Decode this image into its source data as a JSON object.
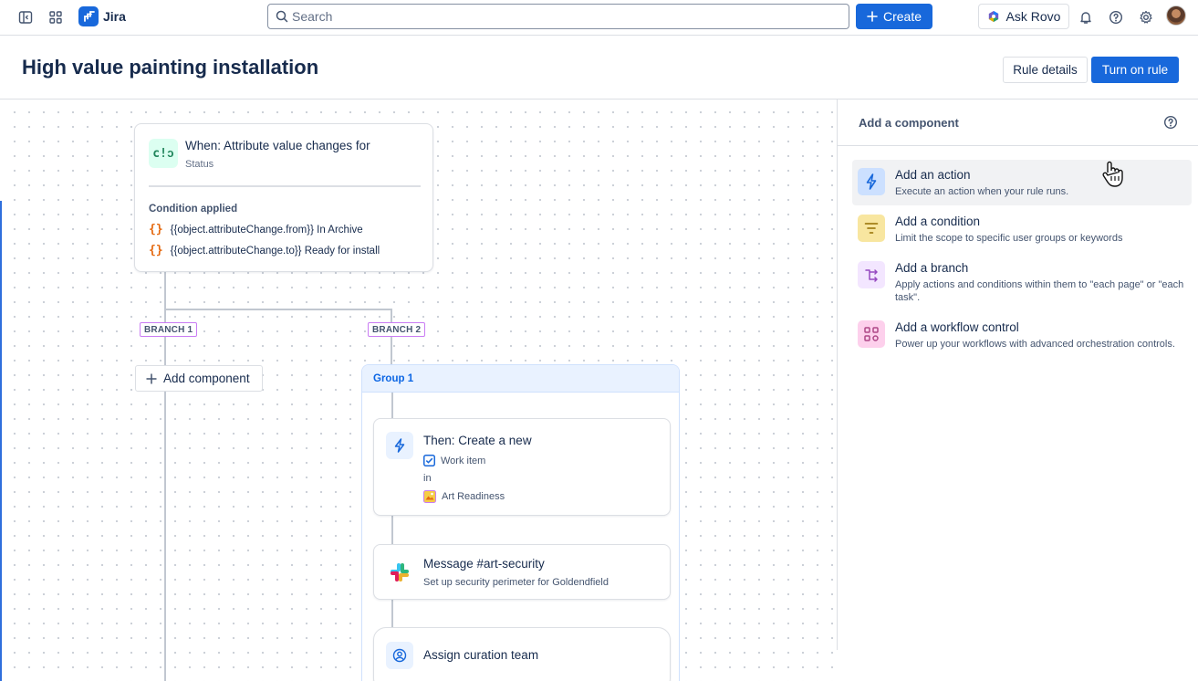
{
  "topnav": {
    "brand": "Jira",
    "search_placeholder": "Search",
    "create_label": "Create",
    "ask_rovo_label": "Ask Rovo",
    "icons": [
      "sidebar-toggle-icon",
      "app-switcher-icon",
      "jira-logo-icon",
      "bell-icon",
      "help-icon",
      "settings-icon",
      "avatar"
    ]
  },
  "header": {
    "title": "High value painting installation",
    "rule_details_label": "Rule details",
    "turn_on_label": "Turn on rule"
  },
  "canvas": {
    "trigger": {
      "title": "When: Attribute value changes for",
      "subtitle": "Status",
      "condition_label": "Condition applied",
      "conditions": [
        {
          "expr": "{{object.attributeChange.from}}",
          "value": "In Archive"
        },
        {
          "expr": "{{object.attributeChange.to}}",
          "value": "Ready for install"
        }
      ]
    },
    "branches": [
      {
        "label": "BRANCH 1"
      },
      {
        "label": "BRANCH 2"
      }
    ],
    "add_component_label": "Add component",
    "group": {
      "title": "Group 1",
      "actions": [
        {
          "title": "Then: Create a new",
          "item": "Work item",
          "in_label": "in",
          "project": "Art Readiness"
        },
        {
          "title": "Message #art-security",
          "subtitle": "Set up security perimeter for Goldendfield"
        },
        {
          "title": "Assign curation team"
        }
      ]
    }
  },
  "panel": {
    "title": "Add a component",
    "options": [
      {
        "title": "Add an action",
        "desc": "Execute an action when your rule runs.",
        "color": "#1868db"
      },
      {
        "title": "Add a condition",
        "desc": "Limit the scope to specific user groups or keywords",
        "color": "#f5cd47"
      },
      {
        "title": "Add a branch",
        "desc": "Apply actions and conditions within them to \"each page\" or \"each task\".",
        "color": "#c97cf4"
      },
      {
        "title": "Add a workflow control",
        "desc": "Power up your workflows with advanced orchestration controls.",
        "color": "#e774bb"
      }
    ]
  },
  "colors": {
    "accent": "#1868db",
    "text": "#172b4d",
    "subtle_text": "#44546f",
    "border": "#dcdfe4"
  }
}
